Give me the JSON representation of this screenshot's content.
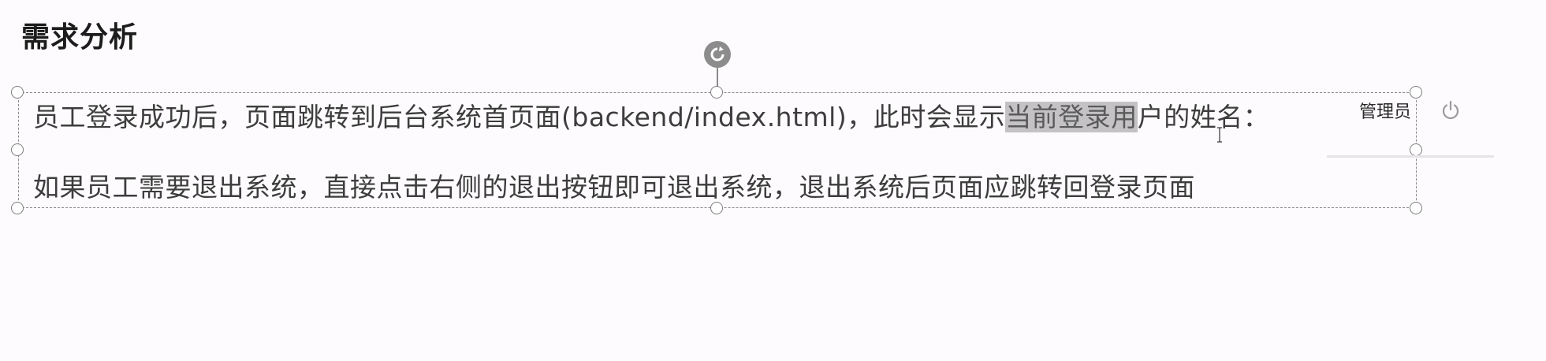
{
  "page": {
    "title": "需求分析"
  },
  "textbox": {
    "line1_before": "员工登录成功后，页面跳转到后台系统首页面(backend/index.html)，此时会显示",
    "line1_highlight": "当前登录用",
    "line1_after": "户的姓名：",
    "line2": "如果员工需要退出系统，直接点击右侧的退出按钮即可退出系统，退出系统后页面应跳转回登录页面"
  },
  "header": {
    "user_name": "管理员",
    "logout_icon": "power-icon"
  },
  "colors": {
    "background": "#fdfbfd",
    "highlight": "#c4c2c5",
    "frame": "#8a8a8a"
  }
}
